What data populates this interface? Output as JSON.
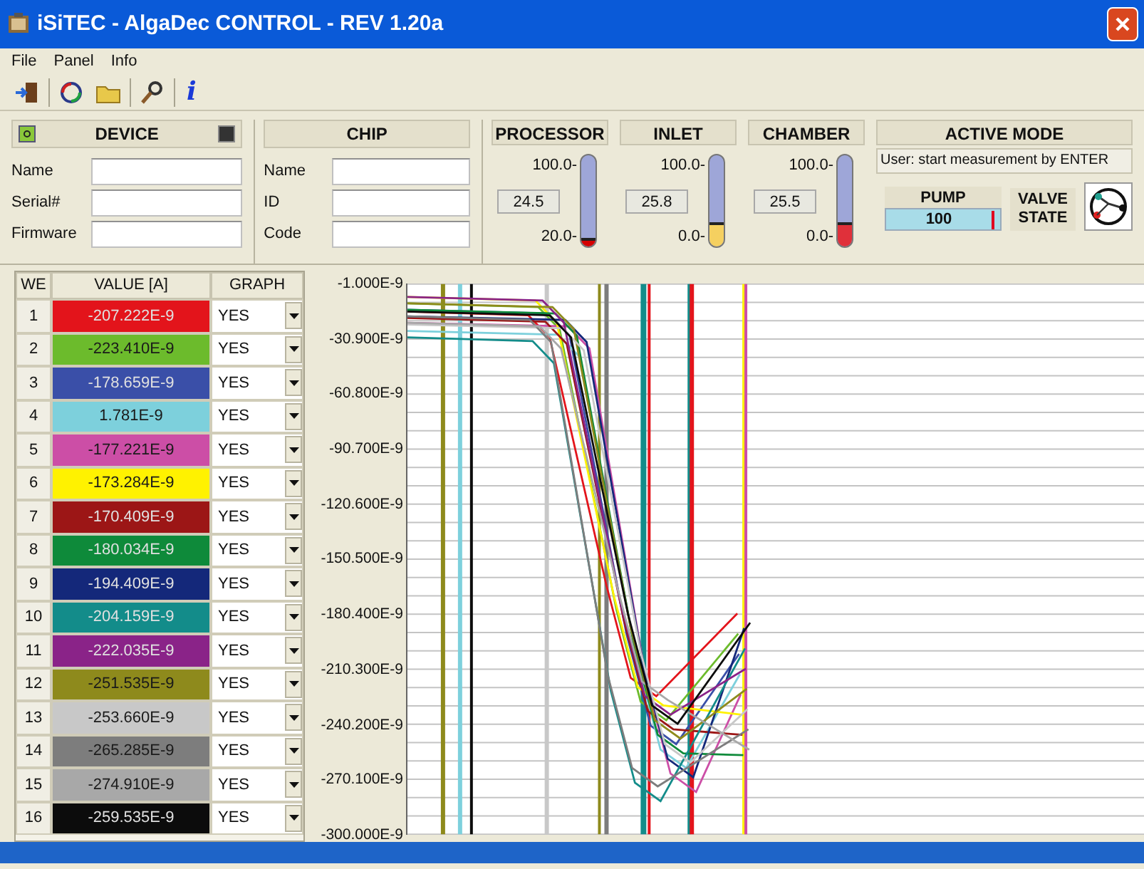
{
  "window": {
    "title": "iSiTEC - AlgaDec CONTROL - REV 1.20a"
  },
  "menu": [
    "File",
    "Panel",
    "Info"
  ],
  "toolbar": [
    {
      "kind": "exit"
    },
    {
      "kind": "refresh"
    },
    {
      "kind": "folder"
    },
    {
      "kind": "search"
    },
    {
      "kind": "info",
      "label": "i"
    }
  ],
  "device": {
    "title": "DEVICE",
    "fields": [
      {
        "label": "Name"
      },
      {
        "label": "Serial#"
      },
      {
        "label": "Firmware"
      }
    ]
  },
  "chip": {
    "title": "CHIP",
    "fields": [
      {
        "label": "Name"
      },
      {
        "label": "ID"
      },
      {
        "label": "Code"
      }
    ]
  },
  "temperatures": [
    {
      "title": "PROCESSOR",
      "max": "100.0-",
      "min": "20.0-",
      "value": "24.5",
      "level": 0.06,
      "color": "#d40000"
    },
    {
      "title": "INLET",
      "max": "100.0-",
      "min": "0.0-",
      "value": "25.8",
      "level": 0.26,
      "color": "#f5d060"
    },
    {
      "title": "CHAMBER",
      "max": "100.0-",
      "min": "0.0-",
      "value": "25.5",
      "level": 0.26,
      "color": "#e0303a"
    }
  ],
  "active_mode": {
    "title": "ACTIVE MODE",
    "message": "User: start measurement by ENTER",
    "pump": {
      "title": "PUMP",
      "value": "100"
    },
    "valve_label": "VALVE STATE"
  },
  "table": {
    "columns": [
      "WE",
      "VALUE [A]",
      "GRAPH"
    ],
    "rows": [
      {
        "we": "1",
        "value": "-207.222E-9",
        "graph": "YES",
        "color": "#e3141b"
      },
      {
        "we": "2",
        "value": "-223.410E-9",
        "graph": "YES",
        "color": "#6cbb2c"
      },
      {
        "we": "3",
        "value": "-178.659E-9",
        "graph": "YES",
        "color": "#3a4fa8"
      },
      {
        "we": "4",
        "value": "1.781E-9",
        "graph": "YES",
        "color": "#7dd0dc"
      },
      {
        "we": "5",
        "value": "-177.221E-9",
        "graph": "YES",
        "color": "#cc4ea6"
      },
      {
        "we": "6",
        "value": "-173.284E-9",
        "graph": "YES",
        "color": "#fff200"
      },
      {
        "we": "7",
        "value": "-170.409E-9",
        "graph": "YES",
        "color": "#9c1616"
      },
      {
        "we": "8",
        "value": "-180.034E-9",
        "graph": "YES",
        "color": "#0e8a3a"
      },
      {
        "we": "9",
        "value": "-194.409E-9",
        "graph": "YES",
        "color": "#14287a"
      },
      {
        "we": "10",
        "value": "-204.159E-9",
        "graph": "YES",
        "color": "#138c8a"
      },
      {
        "we": "11",
        "value": "-222.035E-9",
        "graph": "YES",
        "color": "#8a2388"
      },
      {
        "we": "12",
        "value": "-251.535E-9",
        "graph": "YES",
        "color": "#8e8a1c"
      },
      {
        "we": "13",
        "value": "-253.660E-9",
        "graph": "YES",
        "color": "#c8c8c8"
      },
      {
        "we": "14",
        "value": "-265.285E-9",
        "graph": "YES",
        "color": "#7d7d7d"
      },
      {
        "we": "15",
        "value": "-274.910E-9",
        "graph": "YES",
        "color": "#a8a8a8"
      },
      {
        "we": "16",
        "value": "-259.535E-9",
        "graph": "YES",
        "color": "#0c0c0c"
      }
    ]
  },
  "chart": {
    "y_ticks": [
      "-1.000E-9",
      "-30.900E-9",
      "-60.800E-9",
      "-90.700E-9",
      "-120.600E-9",
      "-150.500E-9",
      "-180.400E-9",
      "-210.300E-9",
      "-240.200E-9",
      "-270.100E-9",
      "-300.000E-9"
    ]
  }
}
